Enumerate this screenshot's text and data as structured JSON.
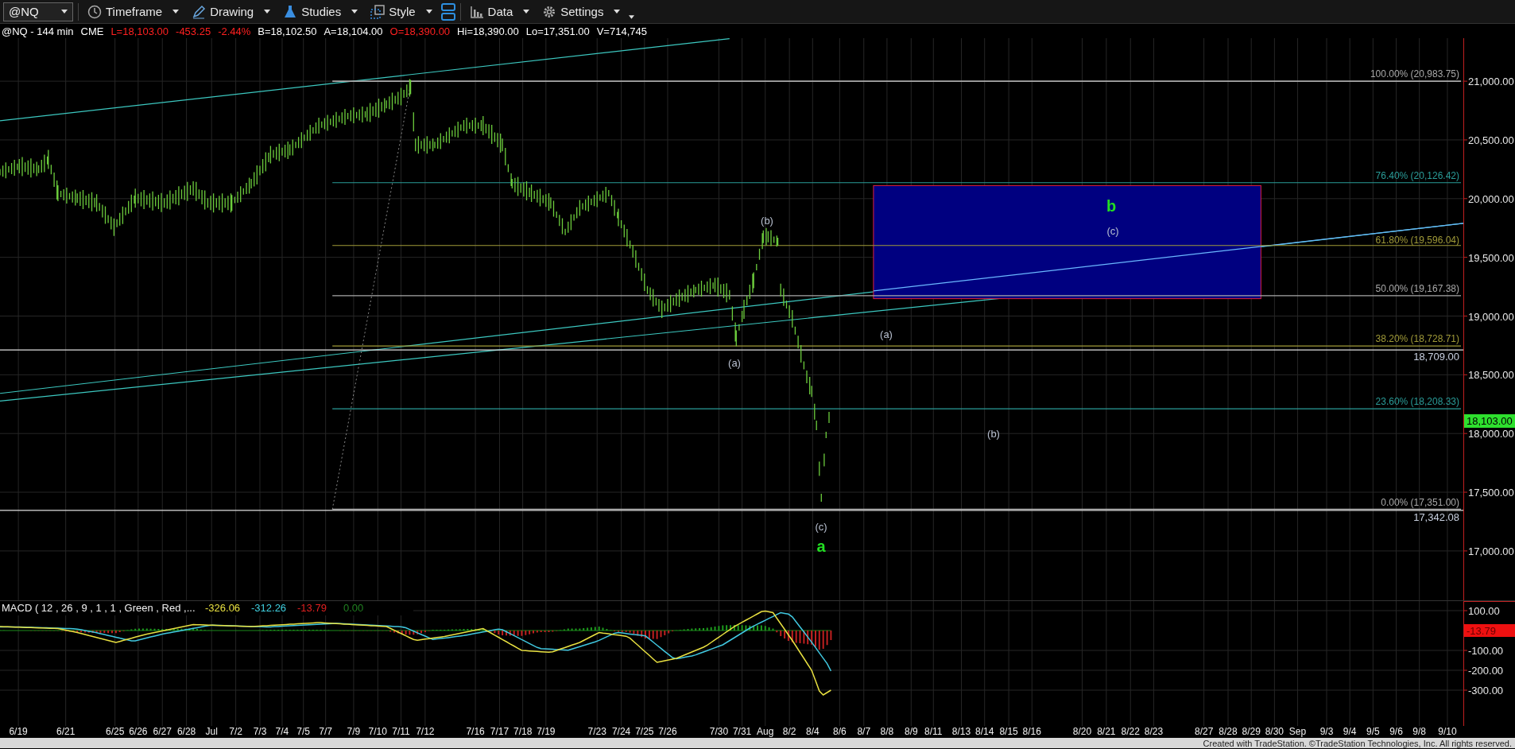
{
  "toolbar": {
    "symbol": "@NQ",
    "menus": [
      {
        "label": "Timeframe"
      },
      {
        "label": "Drawing"
      },
      {
        "label": "Studies"
      },
      {
        "label": "Style"
      },
      {
        "label": "Data"
      },
      {
        "label": "Settings"
      }
    ]
  },
  "info_bar": [
    {
      "text": "@NQ - 144 min",
      "color": "#ffffff"
    },
    {
      "text": "CME",
      "color": "#ffffff"
    },
    {
      "text": "L=18,103.00",
      "color": "#ff2020"
    },
    {
      "text": "-453.25",
      "color": "#ff2020"
    },
    {
      "text": "-2.44%",
      "color": "#ff2020"
    },
    {
      "text": "B=18,102.50",
      "color": "#ffffff"
    },
    {
      "text": "A=18,104.00",
      "color": "#ffffff"
    },
    {
      "text": "O=18,390.00",
      "color": "#ff2020"
    },
    {
      "text": "Hi=18,390.00",
      "color": "#ffffff"
    },
    {
      "text": "Lo=17,351.00",
      "color": "#ffffff"
    },
    {
      "text": "V=714,745",
      "color": "#ffffff"
    }
  ],
  "price_chart": {
    "fib_levels": [
      {
        "label": "100.00% (20,983.75)",
        "color": "#a8a8a8"
      },
      {
        "label": "76.40% (20,126.42)",
        "color": "#2a9c98"
      },
      {
        "label": "61.80% (19,596.04)",
        "color": "#a09a38"
      },
      {
        "label": "50.00% (19,167.38)",
        "color": "#a8a8a8"
      },
      {
        "label": "38.20% (18,728.71)",
        "color": "#a09a38"
      },
      {
        "label": "23.60% (18,208.33)",
        "color": "#2a9c98"
      },
      {
        "label": "0.00% (17,351.00)",
        "color": "#a8a8a8"
      }
    ],
    "line_labels": [
      "18,709.00",
      "17,342.08"
    ],
    "wave_labels": [
      {
        "text": "b",
        "kind": "major"
      },
      {
        "text": "(b)",
        "kind": "minor"
      },
      {
        "text": "(c)",
        "kind": "minor"
      },
      {
        "text": "(a)",
        "kind": "minor"
      },
      {
        "text": "(a)",
        "kind": "minor"
      },
      {
        "text": "(b)",
        "kind": "minor"
      },
      {
        "text": "(c)",
        "kind": "minor"
      },
      {
        "text": "a",
        "kind": "major"
      }
    ],
    "price_axis": [
      "21,000.00",
      "20,500.00",
      "20,000.00",
      "19,500.00",
      "19,000.00",
      "18,500.00",
      "18,000.00",
      "17,500.00",
      "17,000.00"
    ],
    "last_price": "18,103.00"
  },
  "macd": {
    "title": "MACD ( 12 , 26 , 9 , 1 , 1 , Green , Red ,...",
    "values": [
      {
        "text": "-326.06",
        "color": "#e8e040"
      },
      {
        "text": "-312.26",
        "color": "#40d0e0"
      },
      {
        "text": "-13.79",
        "color": "#e02020"
      },
      {
        "text": "0.00",
        "color": "#208020"
      }
    ],
    "axis": [
      "100.00",
      "-100.00",
      "-200.00",
      "-300.00"
    ],
    "last_value": "-13.79"
  },
  "date_axis": [
    "6/19",
    "6/21",
    "6/25",
    "6/26",
    "6/27",
    "6/28",
    "Jul",
    "7/2",
    "7/3",
    "7/4",
    "7/5",
    "7/7",
    "7/9",
    "7/10",
    "7/11",
    "7/12",
    "7/16",
    "7/17",
    "7/18",
    "7/19",
    "7/23",
    "7/24",
    "7/25",
    "7/26",
    "7/30",
    "7/31",
    "Aug",
    "8/2",
    "8/4",
    "8/6",
    "8/7",
    "8/8",
    "8/9",
    "8/11",
    "8/13",
    "8/14",
    "8/15",
    "8/16",
    "8/20",
    "8/21",
    "8/22",
    "8/23",
    "8/27",
    "8/28",
    "8/29",
    "8/30",
    "Sep",
    "9/3",
    "9/4",
    "9/5",
    "9/6",
    "9/8",
    "9/10"
  ],
  "footer": "Created with TradeStation. ©TradeStation Technologies, Inc. All rights reserved."
}
